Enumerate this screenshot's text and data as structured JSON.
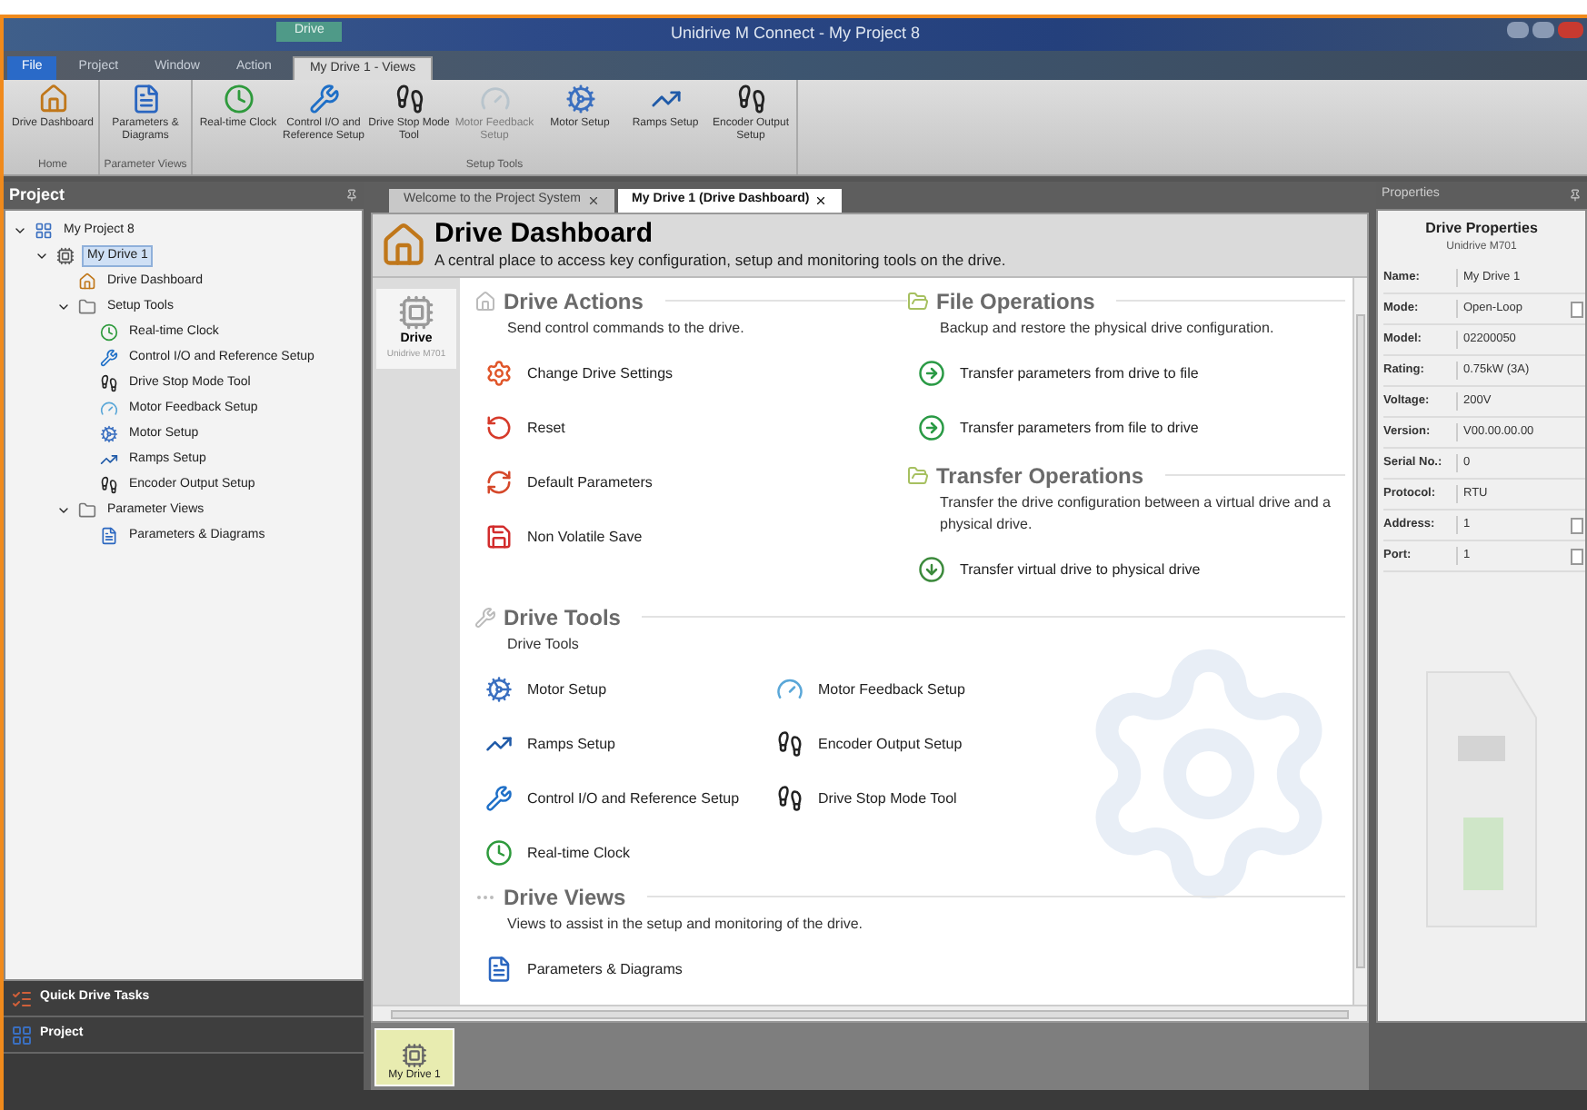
{
  "window": {
    "title": "Unidrive M Connect - My Project 8"
  },
  "ribbon": {
    "context_label": "Drive",
    "tabs": [
      {
        "label": "File",
        "selected": false,
        "kind": "file"
      },
      {
        "label": "Project",
        "selected": false,
        "kind": "plain"
      },
      {
        "label": "Window",
        "selected": false,
        "kind": "plain"
      },
      {
        "label": "Action",
        "selected": false,
        "kind": "plain"
      },
      {
        "label": "My Drive 1 - Views",
        "selected": true,
        "kind": "plain"
      }
    ],
    "groups": [
      {
        "label": "Home",
        "buttons": [
          {
            "label": "Drive Dashboard",
            "kind": "home",
            "disabled": false
          }
        ]
      },
      {
        "label": "Parameter Views",
        "buttons": [
          {
            "label": "Parameters & Diagrams",
            "kind": "params",
            "disabled": false
          }
        ]
      },
      {
        "label": "Setup Tools",
        "buttons": [
          {
            "label": "Real-time Clock",
            "kind": "clock",
            "disabled": false
          },
          {
            "label": "Control I/O and Reference Setup",
            "kind": "wrench",
            "disabled": false
          },
          {
            "label": "Drive Stop Mode Tool",
            "kind": "stop",
            "disabled": false
          },
          {
            "label": "Motor Feedback Setup",
            "kind": "feedback",
            "disabled": true
          },
          {
            "label": "Motor Setup",
            "kind": "motor",
            "disabled": false
          },
          {
            "label": "Ramps Setup",
            "kind": "ramps",
            "disabled": false
          },
          {
            "label": "Encoder Output Setup",
            "kind": "stop",
            "disabled": false
          }
        ]
      }
    ]
  },
  "project_panel": {
    "title": "Project",
    "tree": [
      {
        "label": "My Project 8",
        "kind": "project",
        "selected": false,
        "expanded": true,
        "children": [
          {
            "label": "My Drive 1",
            "kind": "drive",
            "selected": true,
            "expanded": true,
            "children": [
              {
                "label": "Drive Dashboard",
                "kind": "home",
                "selected": false
              },
              {
                "label": "Setup Tools",
                "kind": "folder",
                "selected": false,
                "expanded": true,
                "children": [
                  {
                    "label": "Real-time Clock",
                    "kind": "clock",
                    "selected": false
                  },
                  {
                    "label": "Control I/O and Reference Setup",
                    "kind": "wrench",
                    "selected": false
                  },
                  {
                    "label": "Drive Stop Mode Tool",
                    "kind": "stop",
                    "selected": false
                  },
                  {
                    "label": "Motor Feedback Setup",
                    "kind": "feedback",
                    "selected": false
                  },
                  {
                    "label": "Motor Setup",
                    "kind": "motor",
                    "selected": false
                  },
                  {
                    "label": "Ramps Setup",
                    "kind": "ramps",
                    "selected": false
                  },
                  {
                    "label": "Encoder Output Setup",
                    "kind": "stop",
                    "selected": false
                  }
                ]
              },
              {
                "label": "Parameter Views",
                "kind": "folder",
                "selected": false,
                "expanded": true,
                "children": [
                  {
                    "label": "Parameters & Diagrams",
                    "kind": "params",
                    "selected": false
                  }
                ]
              }
            ]
          }
        ]
      }
    ],
    "nav": [
      {
        "label": "Quick Drive Tasks",
        "kind": "tasks"
      },
      {
        "label": "Project",
        "kind": "project"
      }
    ]
  },
  "document_tabs": [
    {
      "label": "Welcome to the Project System",
      "selected": false
    },
    {
      "label": "My Drive 1 (Drive Dashboard)",
      "selected": true
    }
  ],
  "dashboard": {
    "title": "Drive Dashboard",
    "subtitle": "A central place to access key configuration, setup and monitoring tools on the drive.",
    "drive_card": {
      "label": "Drive",
      "model": "Unidrive M701"
    },
    "left_sections": [
      {
        "title": "Drive Actions",
        "description": "Send control commands to the drive.",
        "items": [
          {
            "label": "Change Drive Settings",
            "kind": "settings"
          },
          {
            "label": "Reset",
            "kind": "reset"
          },
          {
            "label": "Default Parameters",
            "kind": "defaults"
          },
          {
            "label": "Non Volatile Save",
            "kind": "save"
          }
        ]
      }
    ],
    "right_sections": [
      {
        "title": "File Operations",
        "description": "Backup and restore the physical drive configuration.",
        "items": [
          {
            "label": "Transfer parameters from drive to file",
            "kind": "transfer"
          },
          {
            "label": "Transfer parameters from file to drive",
            "kind": "transfer"
          }
        ]
      },
      {
        "title": "Transfer Operations",
        "description": "Transfer the drive configuration between a virtual drive and a physical drive.",
        "items": [
          {
            "label": "Transfer virtual drive to physical drive",
            "kind": "download"
          }
        ]
      }
    ],
    "tools": {
      "title": "Drive Tools",
      "description": "Drive Tools",
      "items": [
        {
          "label": "Motor Setup",
          "kind": "motor"
        },
        {
          "label": "Motor Feedback Setup",
          "kind": "feedback"
        },
        {
          "label": "Ramps Setup",
          "kind": "ramps"
        },
        {
          "label": "Encoder Output Setup",
          "kind": "stop"
        },
        {
          "label": "Control I/O and Reference Setup",
          "kind": "wrench"
        },
        {
          "label": "Drive Stop Mode Tool",
          "kind": "stop"
        },
        {
          "label": "Real-time Clock",
          "kind": "clock"
        }
      ]
    },
    "views": {
      "title": "Drive Views",
      "description": "Views to assist in the setup and monitoring of the drive.",
      "items": [
        {
          "label": "Parameters & Diagrams",
          "kind": "params"
        }
      ]
    }
  },
  "thumbnails": [
    {
      "label": "My Drive 1",
      "selected": true
    }
  ],
  "properties": {
    "panel_title": "Properties",
    "title": "Drive Properties",
    "subtitle": "Unidrive M701",
    "rows": [
      {
        "label": "Name:",
        "value": "My Drive 1",
        "has_button": false
      },
      {
        "label": "Mode:",
        "value": "Open-Loop",
        "has_button": true
      },
      {
        "label": "Model:",
        "value": "02200050",
        "has_button": false
      },
      {
        "label": "Rating:",
        "value": "0.75kW (3A)",
        "has_button": false
      },
      {
        "label": "Voltage:",
        "value": "200V",
        "has_button": false
      },
      {
        "label": "Version:",
        "value": "V00.00.00.00",
        "has_button": false
      },
      {
        "label": "Serial No.:",
        "value": "0",
        "has_button": false
      },
      {
        "label": "Protocol:",
        "value": "RTU",
        "has_button": false
      },
      {
        "label": "Address:",
        "value": "1",
        "has_button": true
      },
      {
        "label": "Port:",
        "value": "1",
        "has_button": true
      }
    ]
  }
}
